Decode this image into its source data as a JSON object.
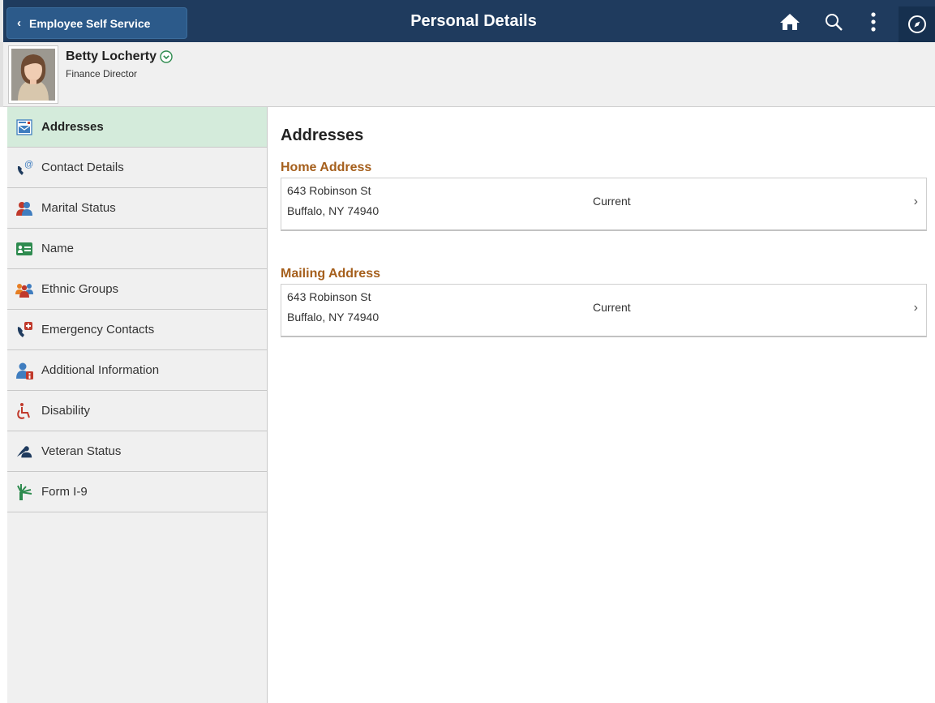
{
  "banner": {
    "back_label": "Employee Self Service",
    "back_chevron": "‹",
    "title": "Personal Details",
    "icons": [
      "home-icon",
      "search-icon",
      "actions-menu-icon",
      "navbar-compass-icon"
    ]
  },
  "employee": {
    "name": "Betty Locherty",
    "job_title": "Finance Director"
  },
  "nav": {
    "items": [
      {
        "label": "Addresses",
        "icon": "addresses-icon",
        "selected": true
      },
      {
        "label": "Contact Details",
        "icon": "contact-details-icon"
      },
      {
        "label": "Marital Status",
        "icon": "marital-status-icon"
      },
      {
        "label": "Name",
        "icon": "name-card-icon"
      },
      {
        "label": "Ethnic Groups",
        "icon": "ethnic-groups-icon"
      },
      {
        "label": "Emergency Contacts",
        "icon": "emergency-contacts-icon"
      },
      {
        "label": "Additional Information",
        "icon": "additional-information-icon"
      },
      {
        "label": "Disability",
        "icon": "disability-icon"
      },
      {
        "label": "Veteran Status",
        "icon": "veteran-status-icon"
      },
      {
        "label": "Form I-9",
        "icon": "form-i9-icon"
      }
    ]
  },
  "main": {
    "title": "Addresses",
    "groups": [
      {
        "title": "Home Address",
        "line1": "643 Robinson St",
        "line2": "Buffalo, NY 74940",
        "status": "Current",
        "chevron": "›"
      },
      {
        "title": "Mailing Address",
        "line1": "643 Robinson St",
        "line2": "Buffalo, NY 74940",
        "status": "Current",
        "chevron": "›"
      }
    ]
  },
  "colors": {
    "banner": "#1f3b5e",
    "back_button": "#2c5a8a",
    "selected_nav": "#d4ebdb",
    "group_title": "#a55f1c"
  }
}
